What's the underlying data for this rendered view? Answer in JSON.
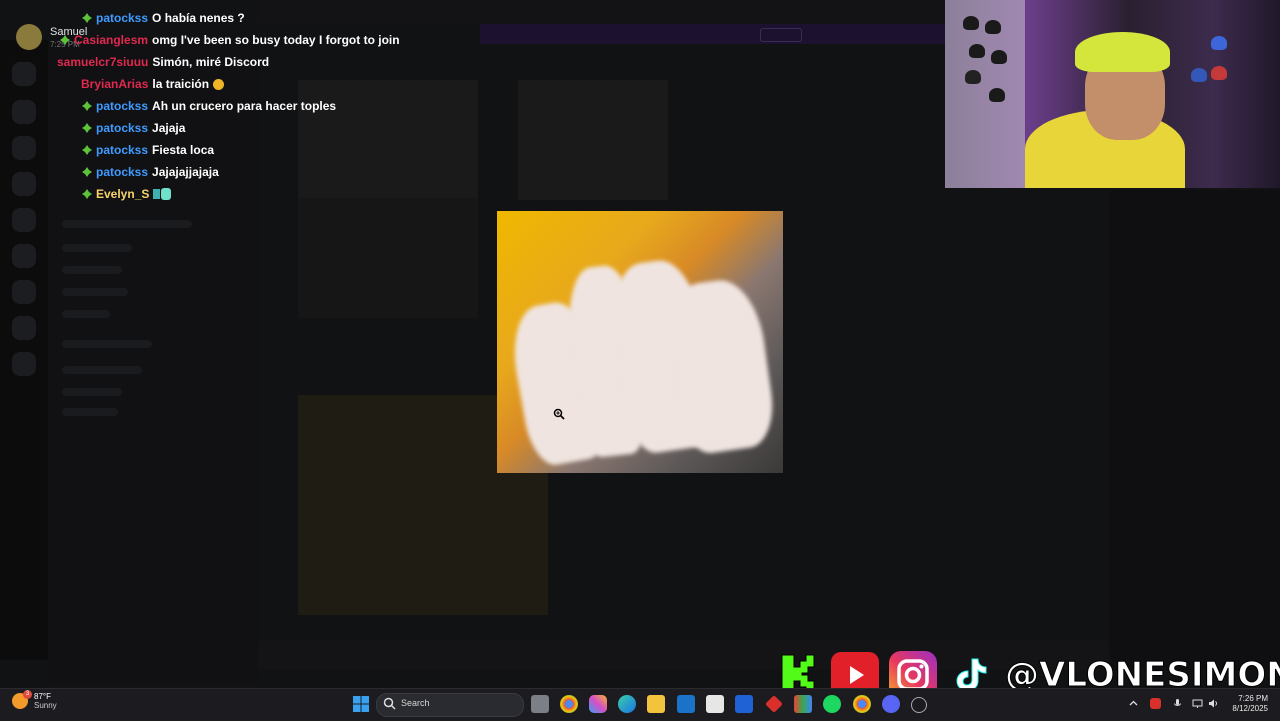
{
  "chat": {
    "discord_user": {
      "name": "Samuel",
      "time": "7:25 PM"
    },
    "lines": [
      {
        "user": "patockss",
        "text": "O había nenes ?",
        "color": "#3f9bff",
        "badge": true
      },
      {
        "user": "Casianglesm",
        "text": "omg I've been so busy today I forgot to join",
        "color": "#e0294f",
        "badge": true
      },
      {
        "user": "samuelcr7siuuu",
        "text": "Simón, miré Discord",
        "color": "#e0294f",
        "badge": false
      },
      {
        "user": "BryianArias",
        "text": "la traición",
        "color": "#e0294f",
        "badge": false
      },
      {
        "user": "patockss",
        "text": "Ah un crucero para hacer toples",
        "color": "#3f9bff",
        "badge": true
      },
      {
        "user": "patockss",
        "text": "Jajaja",
        "color": "#3f9bff",
        "badge": true
      },
      {
        "user": "patockss",
        "text": "Fiesta loca",
        "color": "#3f9bff",
        "badge": true
      },
      {
        "user": "patockss",
        "text": "Jajajajjajaja",
        "color": "#3f9bff",
        "badge": true
      },
      {
        "user": "Evelyn_S",
        "text": "",
        "color": "#f5d36b",
        "badge": true
      }
    ]
  },
  "socials": {
    "handle": "@VLONESIMON"
  },
  "taskbar": {
    "weather_temp": "87°F",
    "weather_desc": "Sunny",
    "weather_badge": "3",
    "search_placeholder": "Search",
    "time": "7:26 PM",
    "date": "8/12/2025"
  },
  "colors": {
    "gem": "#5cc43b",
    "youtube": "#e2202a",
    "kick": "#53fc18"
  },
  "icons": [
    "windows-icon",
    "search-icon",
    "taskview-icon",
    "chrome-icon",
    "copilot-icon",
    "edge-icon",
    "explorer-icon",
    "outlook-icon",
    "store-icon",
    "dropbox-icon",
    "app-icon",
    "spotify-icon",
    "chrome-icon",
    "discord-icon"
  ]
}
